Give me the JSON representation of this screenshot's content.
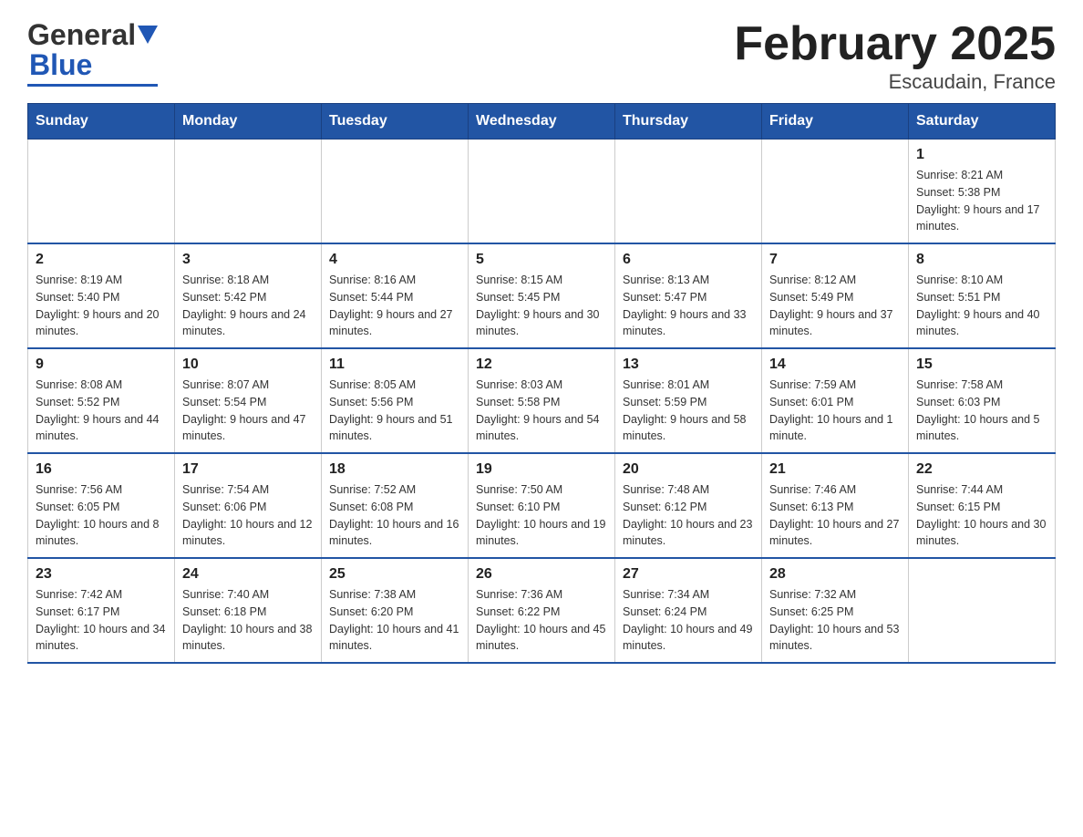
{
  "header": {
    "logo_text_general": "General",
    "logo_text_blue": "Blue",
    "title": "February 2025",
    "subtitle": "Escaudain, France"
  },
  "days_of_week": [
    "Sunday",
    "Monday",
    "Tuesday",
    "Wednesday",
    "Thursday",
    "Friday",
    "Saturday"
  ],
  "weeks": [
    [
      {
        "day": "",
        "info": ""
      },
      {
        "day": "",
        "info": ""
      },
      {
        "day": "",
        "info": ""
      },
      {
        "day": "",
        "info": ""
      },
      {
        "day": "",
        "info": ""
      },
      {
        "day": "",
        "info": ""
      },
      {
        "day": "1",
        "info": "Sunrise: 8:21 AM\nSunset: 5:38 PM\nDaylight: 9 hours and 17 minutes."
      }
    ],
    [
      {
        "day": "2",
        "info": "Sunrise: 8:19 AM\nSunset: 5:40 PM\nDaylight: 9 hours and 20 minutes."
      },
      {
        "day": "3",
        "info": "Sunrise: 8:18 AM\nSunset: 5:42 PM\nDaylight: 9 hours and 24 minutes."
      },
      {
        "day": "4",
        "info": "Sunrise: 8:16 AM\nSunset: 5:44 PM\nDaylight: 9 hours and 27 minutes."
      },
      {
        "day": "5",
        "info": "Sunrise: 8:15 AM\nSunset: 5:45 PM\nDaylight: 9 hours and 30 minutes."
      },
      {
        "day": "6",
        "info": "Sunrise: 8:13 AM\nSunset: 5:47 PM\nDaylight: 9 hours and 33 minutes."
      },
      {
        "day": "7",
        "info": "Sunrise: 8:12 AM\nSunset: 5:49 PM\nDaylight: 9 hours and 37 minutes."
      },
      {
        "day": "8",
        "info": "Sunrise: 8:10 AM\nSunset: 5:51 PM\nDaylight: 9 hours and 40 minutes."
      }
    ],
    [
      {
        "day": "9",
        "info": "Sunrise: 8:08 AM\nSunset: 5:52 PM\nDaylight: 9 hours and 44 minutes."
      },
      {
        "day": "10",
        "info": "Sunrise: 8:07 AM\nSunset: 5:54 PM\nDaylight: 9 hours and 47 minutes."
      },
      {
        "day": "11",
        "info": "Sunrise: 8:05 AM\nSunset: 5:56 PM\nDaylight: 9 hours and 51 minutes."
      },
      {
        "day": "12",
        "info": "Sunrise: 8:03 AM\nSunset: 5:58 PM\nDaylight: 9 hours and 54 minutes."
      },
      {
        "day": "13",
        "info": "Sunrise: 8:01 AM\nSunset: 5:59 PM\nDaylight: 9 hours and 58 minutes."
      },
      {
        "day": "14",
        "info": "Sunrise: 7:59 AM\nSunset: 6:01 PM\nDaylight: 10 hours and 1 minute."
      },
      {
        "day": "15",
        "info": "Sunrise: 7:58 AM\nSunset: 6:03 PM\nDaylight: 10 hours and 5 minutes."
      }
    ],
    [
      {
        "day": "16",
        "info": "Sunrise: 7:56 AM\nSunset: 6:05 PM\nDaylight: 10 hours and 8 minutes."
      },
      {
        "day": "17",
        "info": "Sunrise: 7:54 AM\nSunset: 6:06 PM\nDaylight: 10 hours and 12 minutes."
      },
      {
        "day": "18",
        "info": "Sunrise: 7:52 AM\nSunset: 6:08 PM\nDaylight: 10 hours and 16 minutes."
      },
      {
        "day": "19",
        "info": "Sunrise: 7:50 AM\nSunset: 6:10 PM\nDaylight: 10 hours and 19 minutes."
      },
      {
        "day": "20",
        "info": "Sunrise: 7:48 AM\nSunset: 6:12 PM\nDaylight: 10 hours and 23 minutes."
      },
      {
        "day": "21",
        "info": "Sunrise: 7:46 AM\nSunset: 6:13 PM\nDaylight: 10 hours and 27 minutes."
      },
      {
        "day": "22",
        "info": "Sunrise: 7:44 AM\nSunset: 6:15 PM\nDaylight: 10 hours and 30 minutes."
      }
    ],
    [
      {
        "day": "23",
        "info": "Sunrise: 7:42 AM\nSunset: 6:17 PM\nDaylight: 10 hours and 34 minutes."
      },
      {
        "day": "24",
        "info": "Sunrise: 7:40 AM\nSunset: 6:18 PM\nDaylight: 10 hours and 38 minutes."
      },
      {
        "day": "25",
        "info": "Sunrise: 7:38 AM\nSunset: 6:20 PM\nDaylight: 10 hours and 41 minutes."
      },
      {
        "day": "26",
        "info": "Sunrise: 7:36 AM\nSunset: 6:22 PM\nDaylight: 10 hours and 45 minutes."
      },
      {
        "day": "27",
        "info": "Sunrise: 7:34 AM\nSunset: 6:24 PM\nDaylight: 10 hours and 49 minutes."
      },
      {
        "day": "28",
        "info": "Sunrise: 7:32 AM\nSunset: 6:25 PM\nDaylight: 10 hours and 53 minutes."
      },
      {
        "day": "",
        "info": ""
      }
    ]
  ]
}
